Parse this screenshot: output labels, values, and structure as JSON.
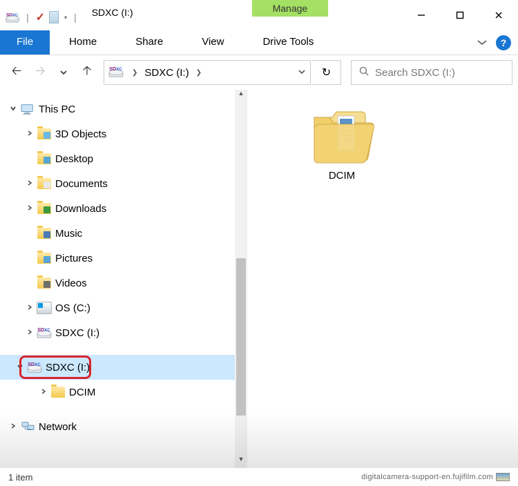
{
  "title": "SDXC (I:)",
  "ribbon": {
    "file": "File",
    "home": "Home",
    "share": "Share",
    "view": "View",
    "manage": "Manage",
    "drive_tools": "Drive Tools"
  },
  "address": {
    "crumb": "SDXC (I:)"
  },
  "search_placeholder": "Search SDXC (I:)",
  "tree": {
    "this_pc": "This PC",
    "items": [
      {
        "label": "3D Objects"
      },
      {
        "label": "Desktop"
      },
      {
        "label": "Documents"
      },
      {
        "label": "Downloads"
      },
      {
        "label": "Music"
      },
      {
        "label": "Pictures"
      },
      {
        "label": "Videos"
      },
      {
        "label": "OS (C:)"
      },
      {
        "label": "SDXC (I:)"
      }
    ],
    "current_drive": "SDXC (I:)",
    "child": "DCIM",
    "network": "Network"
  },
  "content": {
    "folder_name": "DCIM"
  },
  "status": {
    "count": "1 item",
    "watermark": "digitalcamera-support-en.fujifilm.com"
  }
}
